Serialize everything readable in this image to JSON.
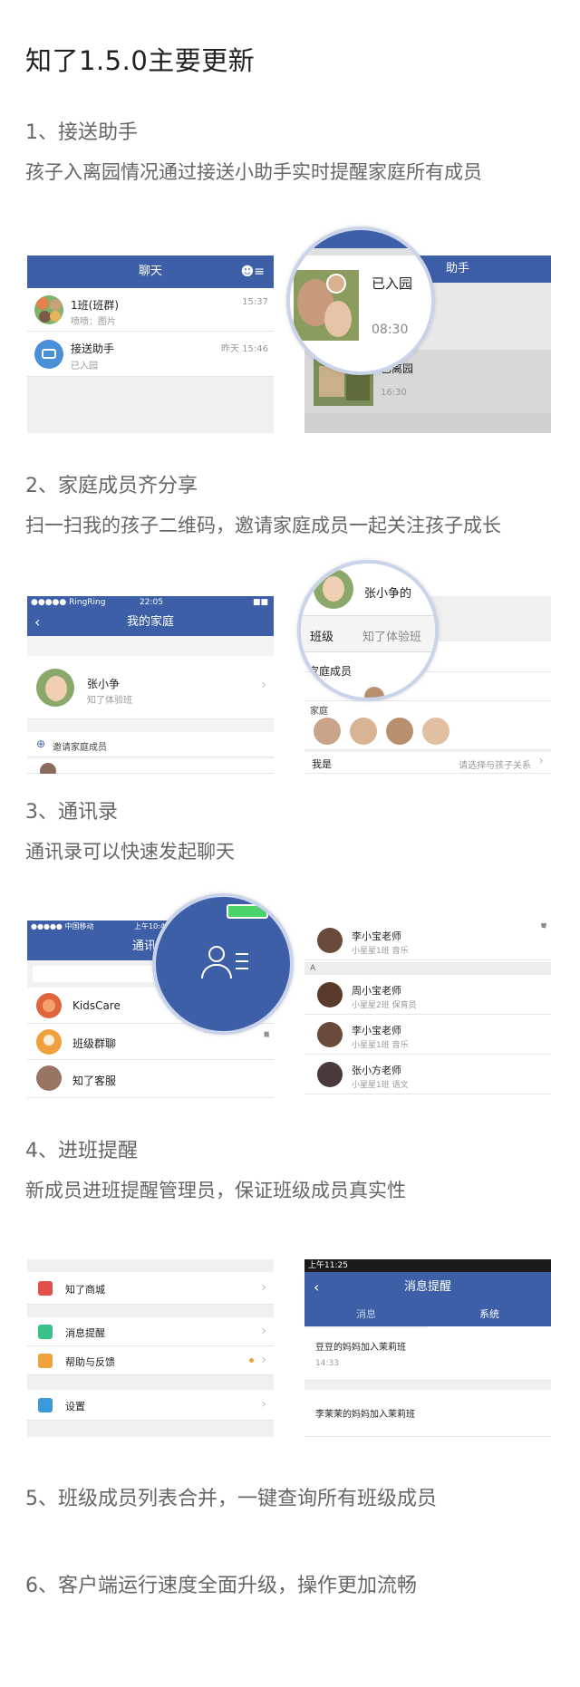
{
  "title": "知了1.5.0主要更新",
  "sections": [
    {
      "heading": "1、接送助手",
      "desc": "孩子入离园情况通过接送小助手实时提醒家庭所有成员"
    },
    {
      "heading": "2、家庭成员齐分享",
      "desc": "扫一扫我的孩子二维码，邀请家庭成员一起关注孩子成长"
    },
    {
      "heading": "3、通讯录",
      "desc": "通讯录可以快速发起聊天"
    },
    {
      "heading": "4、进班提醒",
      "desc": "新成员进班提醒管理员，保证班级成员真实性"
    },
    {
      "heading": "5、班级成员列表合并，一键查询所有班级成员"
    },
    {
      "heading": "6、客户端运行速度全面升级，操作更加流畅"
    }
  ],
  "s1": {
    "left": {
      "header": "聊天",
      "items": [
        {
          "name": "1班(班群)",
          "sub": "喷喷：图片",
          "time": "15:37"
        },
        {
          "name": "接送助手",
          "sub": "已入园",
          "time": "昨天 15:46"
        }
      ]
    },
    "right": {
      "header": "助手",
      "mag_status": "已入园",
      "mag_time": "08:30",
      "item2_status": "已离园",
      "item2_time": "16:30"
    }
  },
  "s2": {
    "left": {
      "carrier": "●●●●● RingRing",
      "clock": "22:05",
      "header": "我的家庭",
      "child_name": "张小争",
      "child_class": "知了体验班",
      "invite": "邀请家庭成员"
    },
    "right": {
      "mag_name": "张小争的",
      "class_label": "班级",
      "class_value": "知了体验班",
      "members_label": "家庭成员",
      "members_label_partial": "家庭",
      "me_label": "我是",
      "me_value": "请选择与孩子关系"
    }
  },
  "s3": {
    "left": {
      "carrier": "●●●●● 中国移动",
      "clock": "上午10:4",
      "header": "通讯",
      "items": [
        "KidsCare",
        "班级群聊",
        "知了客服"
      ],
      "index": [
        "Q",
        "消",
        "A",
        "B",
        "C",
        "D",
        "E"
      ]
    },
    "right": {
      "section": "A",
      "contacts": [
        {
          "name": "李小宝老师",
          "sub": "小星星1班  音乐"
        },
        {
          "name": "周小宝老师",
          "sub": "小星星2班  保育员"
        },
        {
          "name": "李小宝老师",
          "sub": "小星星1班  音乐"
        },
        {
          "name": "张小方老师",
          "sub": "小星星1班  语文"
        }
      ],
      "index": [
        "P",
        "Q",
        "S",
        "T",
        "W",
        "X",
        "Y",
        "Z"
      ]
    }
  },
  "s4": {
    "left": {
      "items": [
        "知了商城",
        "消息提醒",
        "帮助与反馈",
        "设置"
      ]
    },
    "right": {
      "clock": "上午11:25",
      "header": "消息提醒",
      "tabs": [
        "消息",
        "系统"
      ],
      "msgs": [
        {
          "text": "豆豆的妈妈加入茉莉班",
          "time": "14:33"
        },
        {
          "text": "李茉茉的妈妈加入茉莉班"
        }
      ]
    }
  },
  "colors": {
    "primary": "#3d5fa8",
    "text": "#666666",
    "accent_orange": "#f0a03c"
  }
}
